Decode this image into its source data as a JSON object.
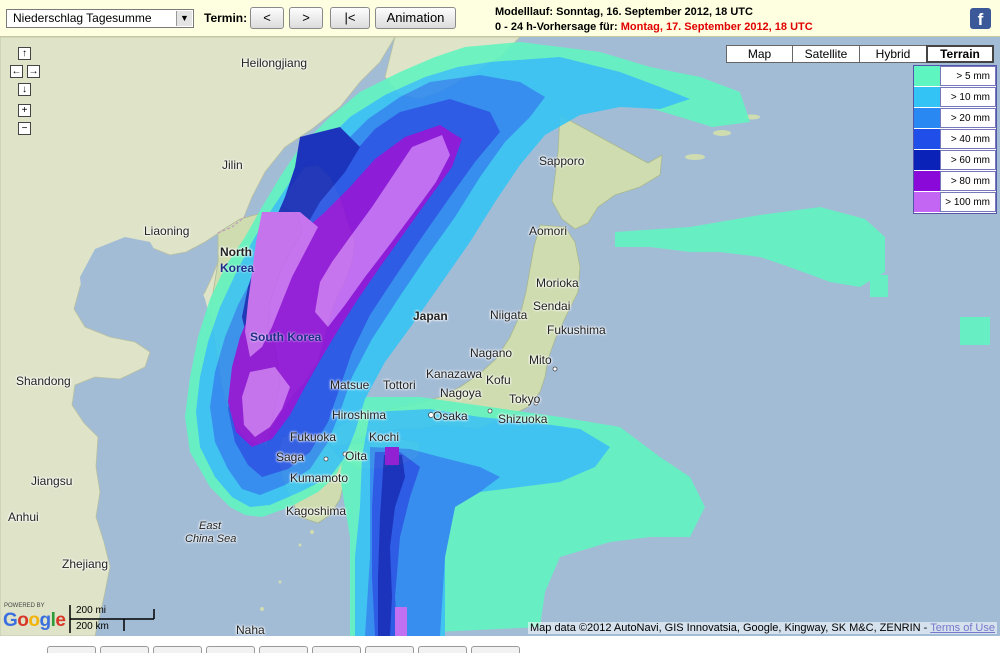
{
  "toolbar": {
    "product_select_value": "Niederschlag Tagesumme",
    "termin_label": "Termin:",
    "prev_label": "<",
    "next_label": ">",
    "first_label": "|<",
    "animation_label": "Animation",
    "modelllauf_text": "Modelllauf: Sonntag, 16. September 2012, 18 UTC",
    "forecast_prefix": "0 - 24 h-Vorhersage für:",
    "forecast_date": "Montag, 17. September 2012, 18 UTC",
    "forecast_date_color": "#e00000",
    "facebook_glyph": "f"
  },
  "map_controls": {
    "pan_up": "↑",
    "pan_left": "←",
    "pan_right": "→",
    "pan_down": "↓",
    "zoom_in": "+",
    "zoom_out": "−"
  },
  "map_types": [
    {
      "label": "Map",
      "active": false
    },
    {
      "label": "Satellite",
      "active": false
    },
    {
      "label": "Hybrid",
      "active": false
    },
    {
      "label": "Terrain",
      "active": true
    }
  ],
  "legend": [
    {
      "label": "> 5 mm",
      "color": "#5ff5c0"
    },
    {
      "label": "> 10 mm",
      "color": "#33c4f5"
    },
    {
      "label": "> 20 mm",
      "color": "#2a88f2"
    },
    {
      "label": "> 40 mm",
      "color": "#1f4fe8"
    },
    {
      "label": "> 60 mm",
      "color": "#0a22b8"
    },
    {
      "label": "> 80 mm",
      "color": "#8a08d8"
    },
    {
      "label": "> 100 mm",
      "color": "#c466f4"
    }
  ],
  "place_labels": {
    "heilongjiang": "Heilongjiang",
    "jilin": "Jilin",
    "liaoning": "Liaoning",
    "north_korea_1": "North",
    "north_korea_2": "Korea",
    "south_korea": "South Korea",
    "shandong": "Shandong",
    "jiangsu": "Jiangsu",
    "anhui": "Anhui",
    "zhejiang": "Zhejiang",
    "east_china_sea_1": "East",
    "east_china_sea_2": "China Sea",
    "japan": "Japan",
    "sapporo": "Sapporo",
    "aomori": "Aomori",
    "morioka": "Morioka",
    "sendai": "Sendai",
    "niigata": "Niigata",
    "fukushima": "Fukushima",
    "nagano": "Nagano",
    "mito": "Mito",
    "kanazawa": "Kanazawa",
    "kofu": "Kofu",
    "matsue": "Matsue",
    "tottori": "Tottori",
    "nagoya": "Nagoya",
    "tokyo": "Tokyo",
    "hiroshima": "Hiroshima",
    "osaka": "Osaka",
    "shizuoka": "Shizuoka",
    "fukuoka": "Fukuoka",
    "kochi": "Kochi",
    "saga": "Saga",
    "oita": "Oita",
    "kumamoto": "Kumamoto",
    "kagoshima": "Kagoshima",
    "naha": "Naha"
  },
  "scale": {
    "miles": "200 mi",
    "km": "200 km"
  },
  "attribution": {
    "text": "Map data ©2012 AutoNavi, GIS Innovatsia, Google, Kingway, SK M&C, ZENRIN -",
    "terms_link": "Terms of Use"
  },
  "branding": {
    "powered_by": "POWERED BY",
    "google": "Google"
  }
}
